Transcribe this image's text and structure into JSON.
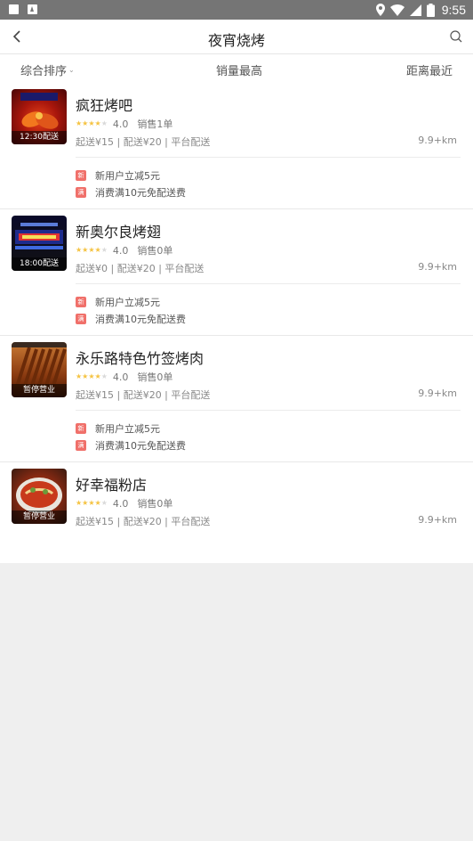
{
  "status_bar": {
    "time": "9:55"
  },
  "nav": {
    "title": "夜宵烧烤"
  },
  "filters": [
    {
      "label": "综合排序",
      "caret": "⌄"
    },
    {
      "label": "销量最高"
    },
    {
      "label": "距离最近"
    }
  ],
  "colors": {
    "star": "#f5c342",
    "star_empty": "#d9d9d9",
    "badge_new": "#f0706a",
    "badge_full": "#f0706a"
  },
  "shops": [
    {
      "name": "疯狂烤吧",
      "thumb_label": "12:30配送",
      "rating_stars": 4,
      "score": "4.0",
      "sales": "销售1单",
      "fees": "起送¥15 | 配送¥20 | 平台配送",
      "distance": "9.9+km",
      "promos": [
        {
          "badge": "新",
          "text": "新用户立减5元"
        },
        {
          "badge": "满",
          "text": "消费满10元免配送费"
        }
      ]
    },
    {
      "name": "新奥尔良烤翅",
      "thumb_label": "18:00配送",
      "rating_stars": 4,
      "score": "4.0",
      "sales": "销售0单",
      "fees": "起送¥0 | 配送¥20 | 平台配送",
      "distance": "9.9+km",
      "promos": [
        {
          "badge": "新",
          "text": "新用户立减5元"
        },
        {
          "badge": "满",
          "text": "消费满10元免配送费"
        }
      ]
    },
    {
      "name": "永乐路特色竹签烤肉",
      "thumb_label": "暂停营业",
      "rating_stars": 4,
      "score": "4.0",
      "sales": "销售0单",
      "fees": "起送¥15 | 配送¥20 | 平台配送",
      "distance": "9.9+km",
      "promos": [
        {
          "badge": "新",
          "text": "新用户立减5元"
        },
        {
          "badge": "满",
          "text": "消费满10元免配送费"
        }
      ]
    },
    {
      "name": "好幸福粉店",
      "thumb_label": "暂停营业",
      "rating_stars": 4,
      "score": "4.0",
      "sales": "销售0单",
      "fees": "起送¥15 | 配送¥20 | 平台配送",
      "distance": "9.9+km",
      "promos": []
    }
  ]
}
